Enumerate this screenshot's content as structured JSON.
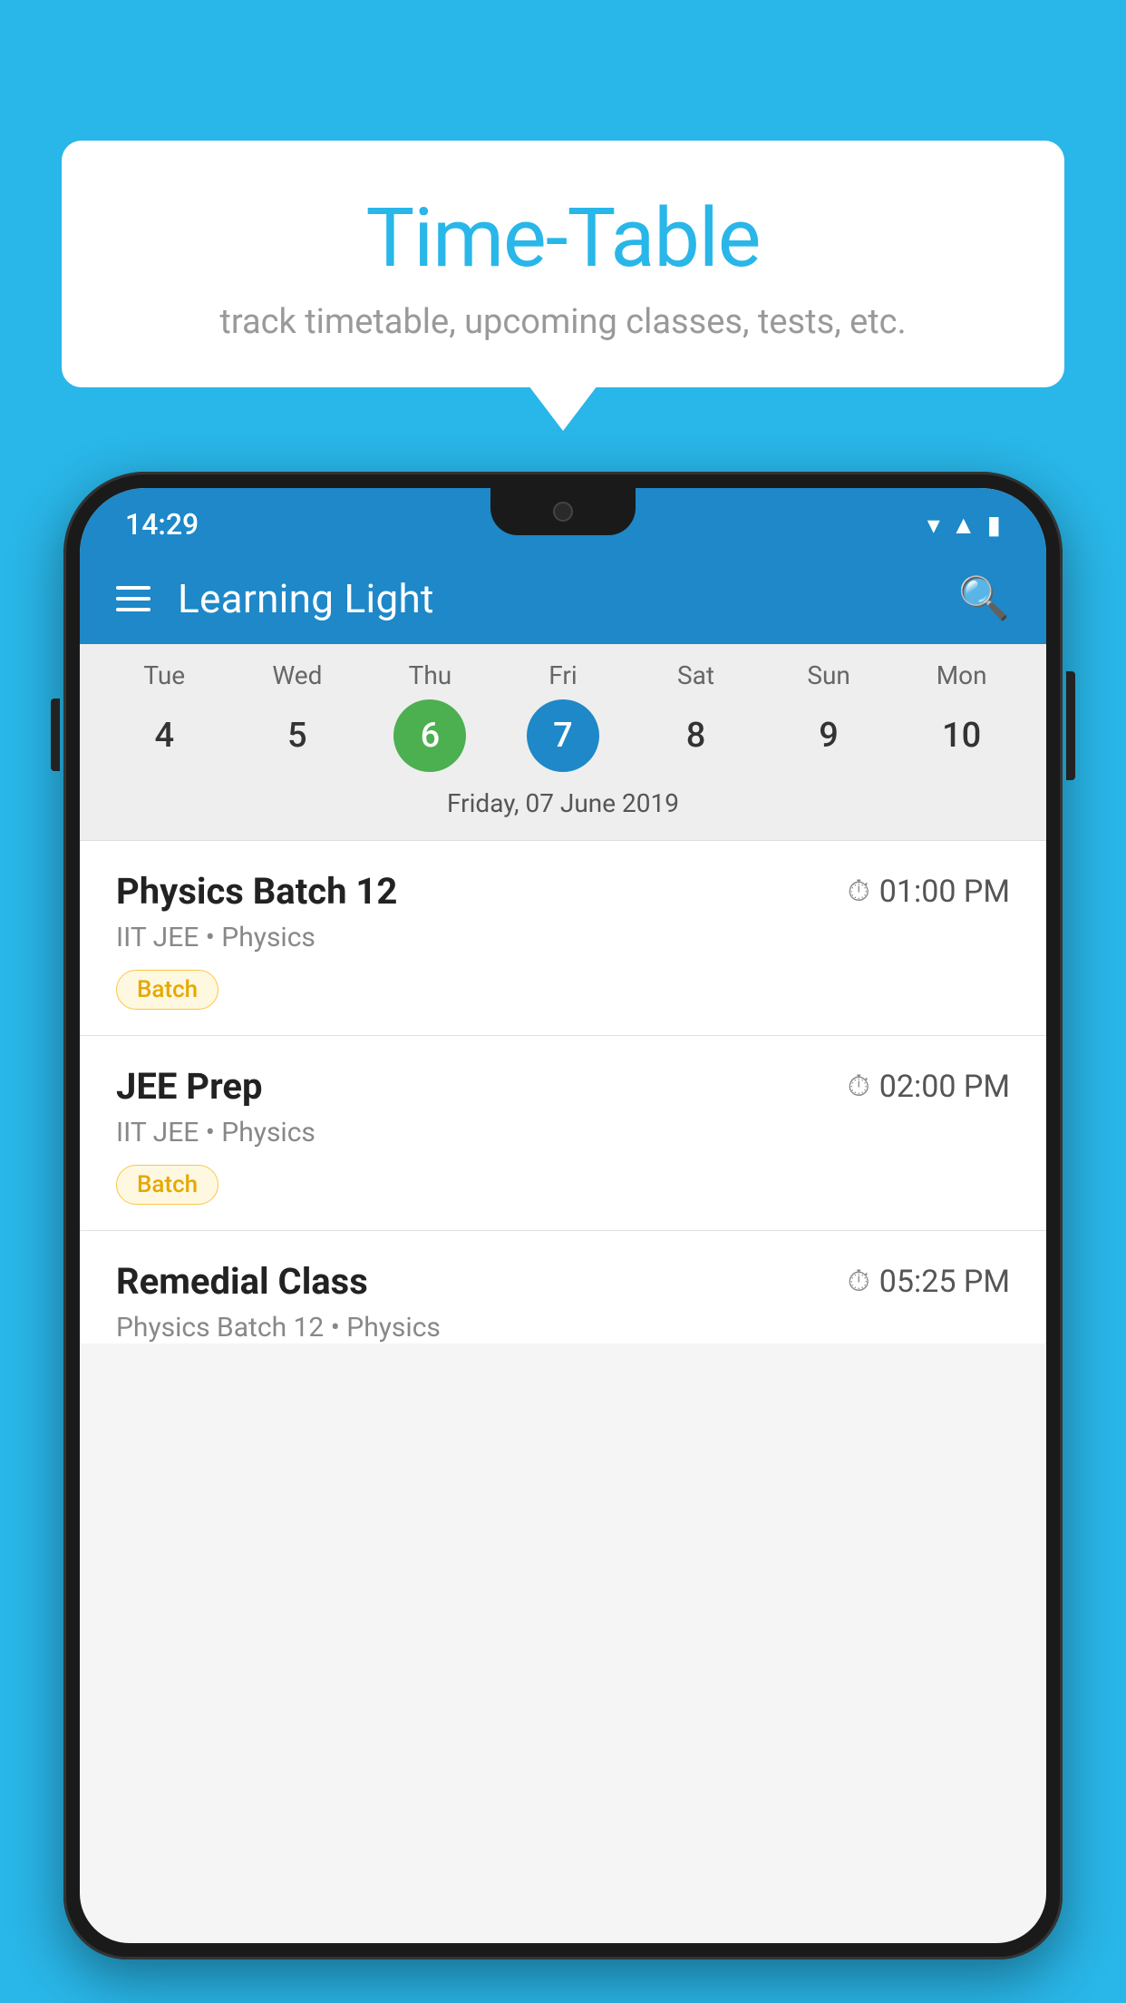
{
  "background_color": "#29b6e8",
  "bubble": {
    "title": "Time-Table",
    "subtitle": "track timetable, upcoming classes, tests, etc."
  },
  "phone": {
    "status_bar": {
      "time": "14:29"
    },
    "app_bar": {
      "title": "Learning Light"
    },
    "calendar": {
      "days": [
        {
          "label": "Tue",
          "num": "4"
        },
        {
          "label": "Wed",
          "num": "5"
        },
        {
          "label": "Thu",
          "num": "6",
          "state": "today"
        },
        {
          "label": "Fri",
          "num": "7",
          "state": "selected"
        },
        {
          "label": "Sat",
          "num": "8"
        },
        {
          "label": "Sun",
          "num": "9"
        },
        {
          "label": "Mon",
          "num": "10"
        }
      ],
      "selected_date_label": "Friday, 07 June 2019"
    },
    "classes": [
      {
        "name": "Physics Batch 12",
        "time": "01:00 PM",
        "meta": "IIT JEE • Physics",
        "tag": "Batch"
      },
      {
        "name": "JEE Prep",
        "time": "02:00 PM",
        "meta": "IIT JEE • Physics",
        "tag": "Batch"
      },
      {
        "name": "Remedial Class",
        "time": "05:25 PM",
        "meta": "Physics Batch 12 • Physics",
        "tag": null
      }
    ]
  }
}
